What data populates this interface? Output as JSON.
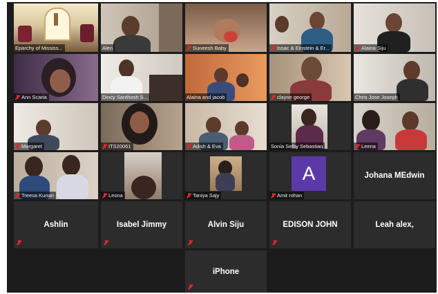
{
  "participants": [
    {
      "name": "Eparchy of Mississ...",
      "label": "Eparchy of Mississ...",
      "muted": false
    },
    {
      "name": "Alen",
      "label": "Alen",
      "muted": false
    },
    {
      "name": "Suneesh Baby",
      "label": "Suneesh Baby",
      "muted": true
    },
    {
      "name": "Issac & Einstein & Er...",
      "label": "Issac & Einstein & Er...",
      "muted": true
    },
    {
      "name": "Alaina Siju",
      "label": "Alaina Siju",
      "muted": true
    },
    {
      "name": "Ann Scaria",
      "label": "Ann Scaria",
      "muted": true
    },
    {
      "name": "Dincy Santhosh S...",
      "label": "Dincy Santhosh S...",
      "muted": false
    },
    {
      "name": "Alaina and jacob",
      "label": "Alaina and jacob",
      "muted": false
    },
    {
      "name": "clayne george",
      "label": "clayne george",
      "muted": true
    },
    {
      "name": "Chris Jose Joseph",
      "label": "Chris Jose Joseph",
      "muted": false
    },
    {
      "name": "Margaret",
      "label": "Margaret",
      "muted": true
    },
    {
      "name": "ITS20061",
      "label": "ITS20061",
      "muted": true
    },
    {
      "name": "Adish & Eva",
      "label": "Adish & Eva",
      "muted": true
    },
    {
      "name": "Sonia Selby Sebastian",
      "label": "Sonia Selby Sebastian",
      "muted": false
    },
    {
      "name": "Leena",
      "label": "Leena",
      "muted": true
    },
    {
      "name": "Treesa Kurian",
      "label": "Treesa Kurian",
      "muted": true
    },
    {
      "name": "Leona",
      "label": "Leona",
      "muted": true
    },
    {
      "name": "Taniya Sajy",
      "label": "Taniya Sajy",
      "muted": true
    },
    {
      "name": "Amit rohan",
      "label": "Amit rohan",
      "muted": true
    },
    {
      "name": "Johana MEdwin",
      "label": "Johana MEdwin",
      "muted": false
    },
    {
      "name": "Ashlin",
      "label": "Ashlin",
      "muted": true
    },
    {
      "name": "Isabel Jimmy",
      "label": "Isabel Jimmy",
      "muted": true
    },
    {
      "name": "Alvin Siju",
      "label": "Alvin Siju",
      "muted": true
    },
    {
      "name": "EDISON JOHN",
      "label": "EDISON JOHN",
      "muted": true
    },
    {
      "name": "Leah alex,",
      "label": "Leah alex,",
      "muted": false
    },
    {
      "name": "iPhone",
      "label": "iPhone",
      "muted": true
    }
  ],
  "avatar_letter": "A",
  "colors": {
    "background": "#1c1c1c",
    "tile": "#2c2c2c",
    "active_border": "#e8d23c",
    "muted_icon": "#e02828",
    "avatar": "#5b3aa8"
  }
}
